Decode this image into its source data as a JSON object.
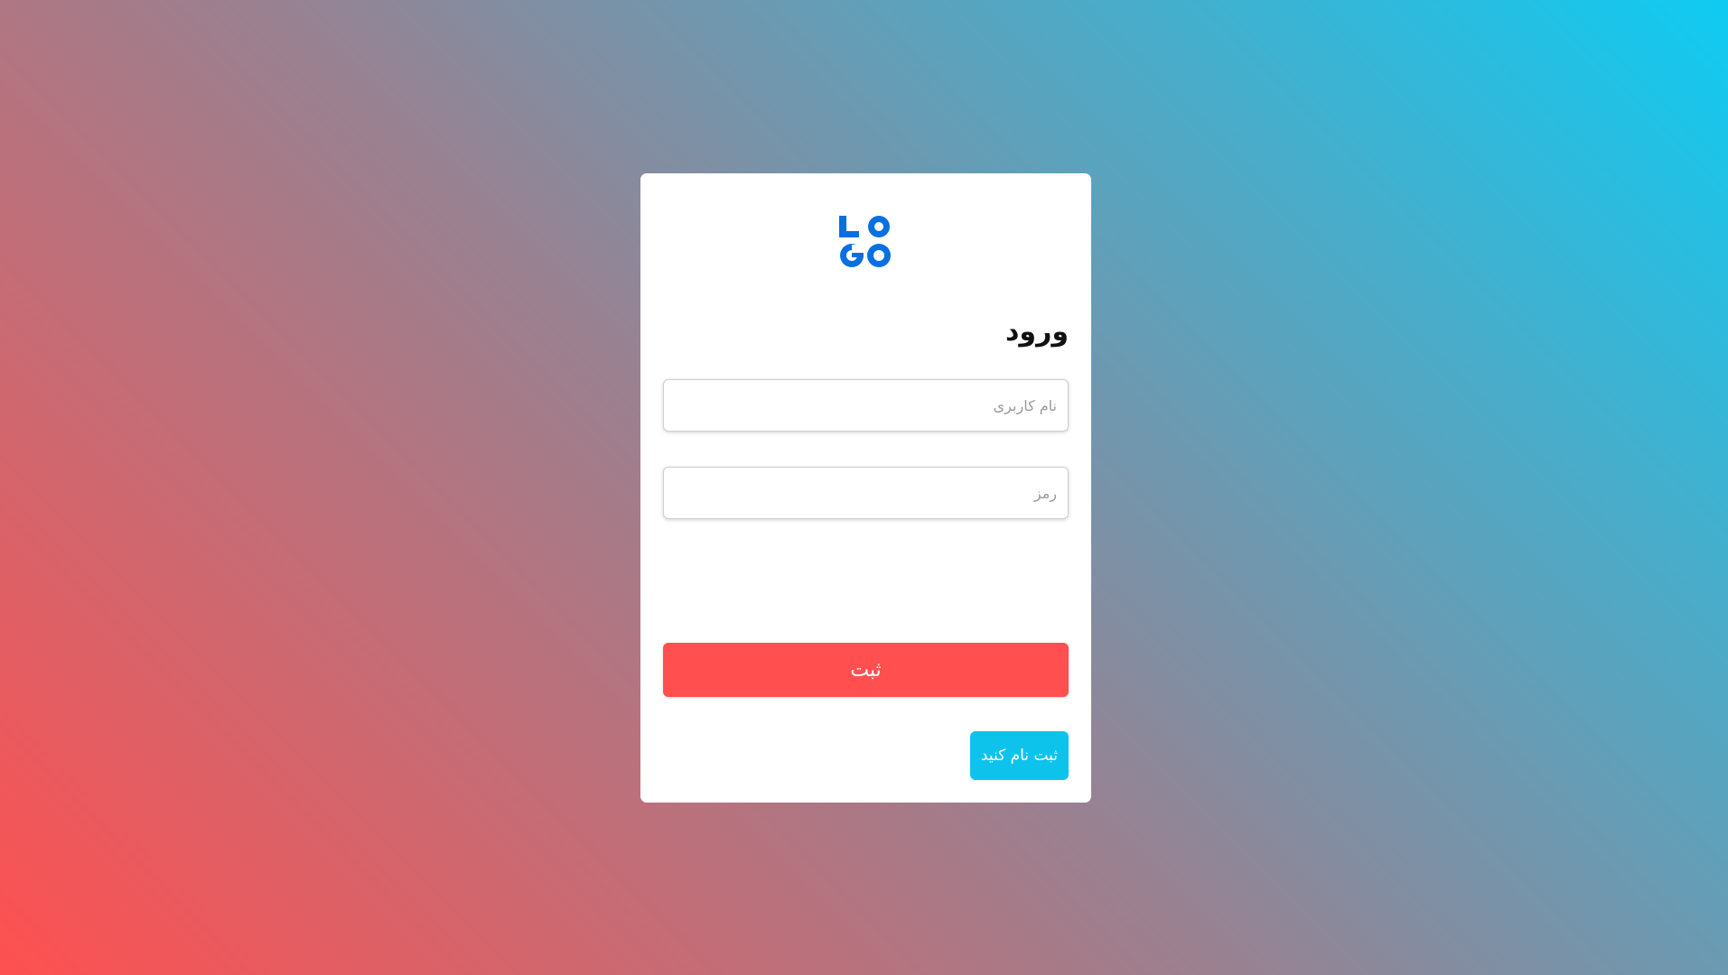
{
  "background": {
    "gradient_start": "#ff5050",
    "gradient_end": "#0fcbf2"
  },
  "logo": {
    "text": "LOGO",
    "color": "#0a6fe0"
  },
  "login": {
    "title": "ورود",
    "username_placeholder": "نام کاربری",
    "username_value": "",
    "password_placeholder": "رمز",
    "password_value": "",
    "submit_label": "ثبت",
    "submit_color": "#ff4f4f",
    "register_label": "ثبت نام کنید",
    "register_color": "#0dc3ec"
  }
}
